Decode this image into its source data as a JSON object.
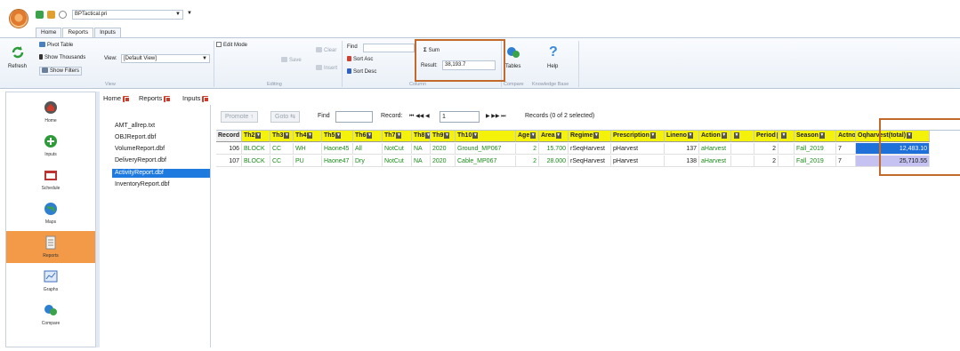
{
  "app": {
    "file_name": "BPTactical.pri",
    "ribbon_tabs": [
      "Home",
      "Reports",
      "Inputs"
    ]
  },
  "ribbon": {
    "refresh": "Refresh",
    "pivot_table": "Pivot Table",
    "show_thousands": "Show Thousands",
    "show_filters": "Show Filters",
    "view_label": "View:",
    "view_value": "[Default View]",
    "view_group": "View",
    "edit_mode": "Edit Mode",
    "save": "Save",
    "clear": "Clear",
    "insert": "Insert",
    "editing_group": "Editing",
    "find_label": "Find",
    "sort_asc": "Sort Asc",
    "sort_desc": "Sort Desc",
    "sum_label": "Sum",
    "result_label": "Result:",
    "result_value": "38,193.7",
    "column_group": "Column",
    "tables": "Tables",
    "help": "Help",
    "compare_group": "Compare",
    "knowledge_group": "Knowledge Base"
  },
  "leftnav": [
    "Home",
    "Inputs",
    "Schedule",
    "Maps",
    "Reports",
    "Graphs",
    "Compare"
  ],
  "doc_tabs": [
    "Home",
    "Reports",
    "Inputs"
  ],
  "files": [
    "AMT_allrep.txt",
    "OBJReport.dbf",
    "VolumeReport.dbf",
    "DeliveryReport.dbf",
    "ActivityReport.dbf",
    "InventoryReport.dbf"
  ],
  "grid_toolbar": {
    "promote": "Promote",
    "goto": "Goto",
    "find": "Find",
    "record_label": "Record:",
    "record_value": "1",
    "records_summary": "Records (0 of 2 selected)"
  },
  "columns": [
    "Record",
    "Th2",
    "Th3",
    "Th4",
    "Th5",
    "Th6",
    "Th7",
    "Th8",
    "Th9",
    "Th10",
    "Age",
    "Area",
    "Regime",
    "Prescription",
    "Lineno",
    "Action",
    "",
    "Period",
    "",
    "Season",
    "Actno",
    "Oqharvest(total)"
  ],
  "rows": [
    [
      "106",
      "BLOCK",
      "CC",
      "WH",
      "Haone45",
      "All",
      "NotCut",
      "NA",
      "2020",
      "Ground_MP067",
      "2",
      "15.700",
      "rSeqHarvest",
      "pHarvest",
      "137",
      "aHarvest",
      "",
      "2",
      "",
      "Fall_2019",
      "7",
      "12,483.10"
    ],
    [
      "107",
      "BLOCK",
      "CC",
      "PU",
      "Haone47",
      "Dry",
      "NotCut",
      "NA",
      "2020",
      "Cable_MP067",
      "2",
      "28.000",
      "rSeqHarvest",
      "pHarvest",
      "138",
      "aHarvest",
      "",
      "2",
      "",
      "Fall_2019",
      "7",
      "25,710.55"
    ]
  ],
  "colors": {
    "header_yellow": "#f4f10a",
    "selection_blue": "#1f70d8",
    "selection_lilac": "#c5c2f2",
    "highlight_orange": "#c26a2b",
    "nav_active": "#f29a48"
  }
}
